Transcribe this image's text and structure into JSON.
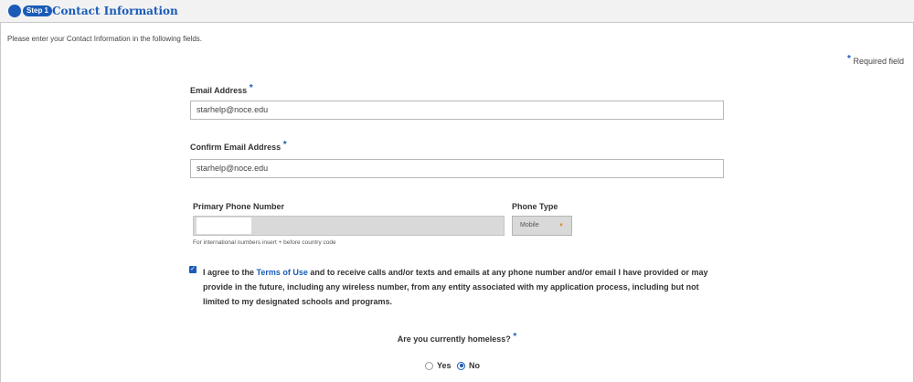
{
  "header": {
    "step_badge": "Step 1",
    "title": "Contact Information"
  },
  "intro": "Please enter your Contact Information in the following fields.",
  "required_note": {
    "star": "*",
    "text": "Required field"
  },
  "email": {
    "label": "Email Address",
    "star": "*",
    "value": "starhelp@noce.edu"
  },
  "confirm_email": {
    "label": "Confirm Email Address",
    "star": "*",
    "value": "starhelp@noce.edu"
  },
  "phone": {
    "label": "Primary Phone Number",
    "value": "",
    "hint": "For international numbers insert + before country code"
  },
  "phone_type": {
    "label": "Phone Type",
    "selected": "Mobile"
  },
  "agreement": {
    "checked": true,
    "prefix": "I agree to the ",
    "link": "Terms of Use",
    "suffix": " and to receive calls and/or texts and emails at any phone number and/or email I have provided or may provide in the future, including any wireless number, from any entity associated with my application process, including but not limited to my designated schools and programs."
  },
  "homeless": {
    "question": "Are you currently homeless?",
    "star": "*",
    "options": [
      {
        "label": "Yes",
        "selected": false
      },
      {
        "label": "No",
        "selected": true
      }
    ]
  },
  "colors": {
    "accent": "#1a5bb8",
    "header_bg": "#f2f2f2",
    "disabled_bg": "#d9d9d9"
  }
}
